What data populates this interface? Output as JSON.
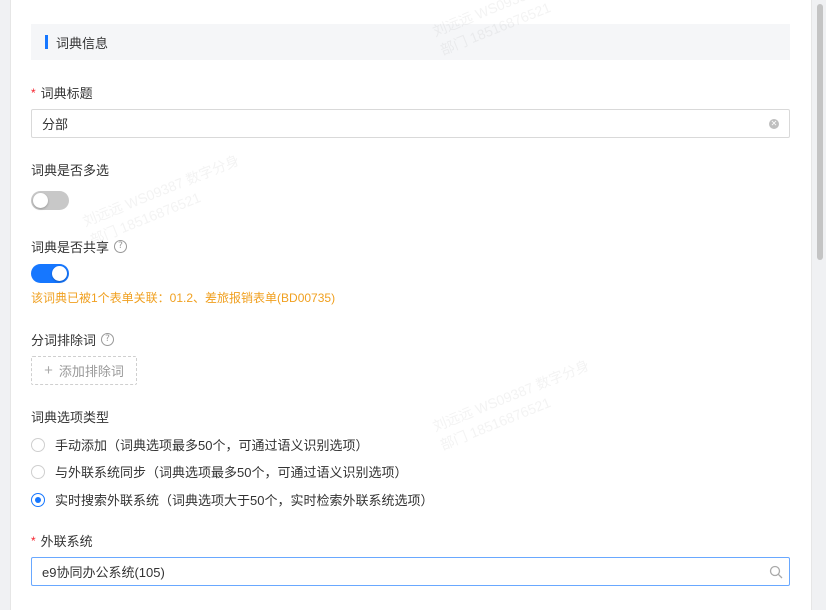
{
  "section": {
    "title": "词典信息"
  },
  "dict_title": {
    "label": "词典标题",
    "value": "分部"
  },
  "multi_select": {
    "label": "词典是否多选",
    "enabled": false
  },
  "shared": {
    "label": "词典是否共享",
    "enabled": true,
    "notice": "该词典已被1个表单关联：01.2、差旅报销表单(BD00735)"
  },
  "exclude_words": {
    "label": "分词排除词",
    "add_label": "添加排除词"
  },
  "option_type": {
    "label": "词典选项类型",
    "options": [
      {
        "label": "手动添加（词典选项最多50个，可通过语义识别选项）",
        "checked": false
      },
      {
        "label": "与外联系统同步（词典选项最多50个，可通过语义识别选项）",
        "checked": false
      },
      {
        "label": "实时搜索外联系统（词典选项大于50个，实时检索外联系统选项）",
        "checked": true
      }
    ]
  },
  "external_system": {
    "label": "外联系统",
    "value": "e9协同办公系统(105)"
  },
  "watermark": {
    "line1": "刘远远 WS09387 数字分身",
    "line2": "部门 18516876521"
  },
  "colors": {
    "accent": "#1677ff",
    "warning": "#f0a020",
    "required": "#f5222d"
  }
}
